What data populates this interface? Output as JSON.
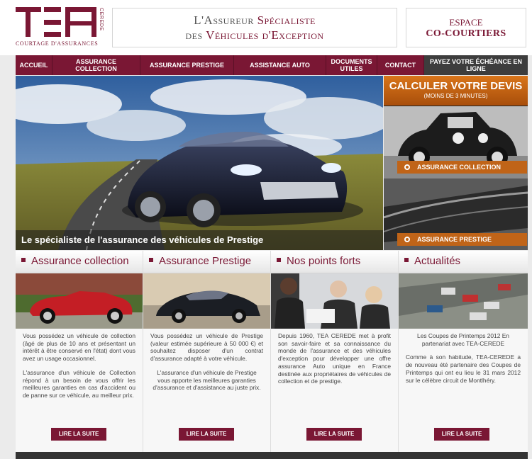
{
  "header": {
    "logo_letters": "TEA",
    "logo_vertical": "CEREDE",
    "logo_subtitle": "COURTAGE D'ASSURANCES",
    "tagline_line1_pre": "L'Assureur ",
    "tagline_line1_accent": "Spécialiste",
    "tagline_line2_pre": "des ",
    "tagline_line2_accent": "Véhicules d'Exception",
    "espace_line1": "ESPACE",
    "espace_line2": "CO-COURTIERS"
  },
  "nav": {
    "items": [
      {
        "label": "ACCUEIL"
      },
      {
        "label": "ASSURANCE COLLECTION"
      },
      {
        "label": "ASSURANCE PRESTIGE"
      },
      {
        "label": "ASSISTANCE AUTO"
      },
      {
        "label": "DOCUMENTS UTILES"
      },
      {
        "label": "CONTACT"
      },
      {
        "label": "PAYEZ VOTRE ÉCHÉANCE EN LIGNE"
      }
    ]
  },
  "hero": {
    "caption": "Le spécialiste de l'assurance des véhicules de Prestige"
  },
  "sidebar": {
    "calc_title": "CALCULER VOTRE DEVIS",
    "calc_subtitle": "(MOINS DE 3 MINUTES)",
    "btn_collection": "ASSURANCE COLLECTION",
    "btn_prestige": "ASSURANCE PRESTIGE"
  },
  "columns": [
    {
      "title": "Assurance collection",
      "p1": "Vous possédez un véhicule de collection (âgé de plus de 10 ans et présentant un intérêt à être conservé en l'état) dont vous avez un usage occasionnel.",
      "p2": "L'assurance d'un véhicule de Collection répond à un besoin de vous offrir les meilleures garanties en cas d'accident ou de panne sur ce véhicule, au meilleur prix.",
      "more": "LIRE LA SUITE"
    },
    {
      "title": "Assurance Prestige",
      "p1": "Vous possédez un véhicule de Prestige (valeur estimée supérieure à 50 000 €) et souhaitez disposer d'un contrat d'assurance adapté à votre véhicule.",
      "p2": "L'assurance d'un véhicule de Prestige vous apporte les meilleures garanties d'assurance et d'assistance au juste prix.",
      "more": "LIRE LA SUITE"
    },
    {
      "title": "Nos points forts",
      "p1": "Depuis 1960, TEA CEREDE met à profit son savoir-faire et sa connaissance du monde de l'assurance et des véhicules d'exception pour développer une offre assurance Auto unique en France destinée aux propriétaires de véhicules de collection et de prestige.",
      "more": "LIRE LA SUITE"
    },
    {
      "title": "Actualités",
      "p1": "Les Coupes de Printemps 2012 En partenariat avec TEA-CEREDE",
      "p2": "Comme à son habitude, TEA-CEREDE a de nouveau été partenaire des Coupes de Printemps qui ont eu lieu le 31 mars 2012 sur le célèbre circuit de Montlhéry.",
      "more": "LIRE LA SUITE"
    }
  ],
  "colors": {
    "brand": "#7a1734",
    "orange": "#c06418",
    "dark": "#3d3d3d"
  }
}
